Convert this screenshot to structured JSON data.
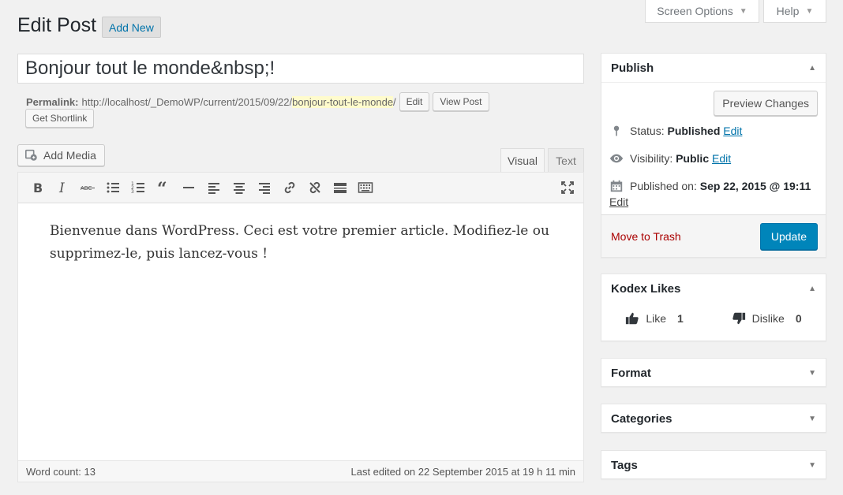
{
  "screen_meta": {
    "screen_options_label": "Screen Options",
    "help_label": "Help",
    "caret": "▼"
  },
  "header": {
    "title": "Edit Post",
    "add_new_label": "Add New"
  },
  "post": {
    "title_value": "Bonjour tout le monde&nbsp;!",
    "permalink_label": "Permalink:",
    "permalink_base": "http://localhost/_DemoWP/current/2015/09/22/",
    "permalink_slug": "bonjour-tout-le-monde",
    "permalink_trailing": "/",
    "edit_label": "Edit",
    "view_post_label": "View Post",
    "get_shortlink_label": "Get Shortlink"
  },
  "editor": {
    "add_media_label": "Add Media",
    "tab_visual": "Visual",
    "tab_text": "Text",
    "content": "Bienvenue dans WordPress. Ceci est votre premier article. Modifiez-le ou supprimez-le, puis lancez-vous !",
    "word_count": "Word count: 13",
    "last_edited": "Last edited on 22 September 2015 at 19 h 11 min",
    "toolbar_icons": [
      "bold-icon",
      "italic-icon",
      "strikethrough-icon",
      "bulleted-list-icon",
      "numbered-list-icon",
      "blockquote-icon",
      "horizontal-line-icon",
      "align-left-icon",
      "align-center-icon",
      "align-right-icon",
      "insert-link-icon",
      "remove-link-icon",
      "read-more-icon",
      "toolbar-toggle-icon",
      "fullscreen-icon"
    ]
  },
  "publish": {
    "title": "Publish",
    "preview_label": "Preview Changes",
    "status_label": "Status:",
    "status_value": "Published",
    "visibility_label": "Visibility:",
    "visibility_value": "Public",
    "published_on_label": "Published on:",
    "published_on_value": "Sep 22, 2015 @ 19:11",
    "edit_link": "Edit",
    "trash_label": "Move to Trash",
    "update_label": "Update"
  },
  "kodex": {
    "title": "Kodex Likes",
    "like_label": "Like",
    "like_count": "1",
    "dislike_label": "Dislike",
    "dislike_count": "0"
  },
  "boxes": {
    "format": "Format",
    "categories": "Categories",
    "tags": "Tags",
    "expanded_toggle": "▲",
    "collapsed_toggle": "▼"
  },
  "colors": {
    "accent": "#0073aa",
    "primary_button": "#0085ba",
    "trash": "#a00000",
    "slug_highlight": "#fffbcc",
    "background": "#f1f1f1"
  }
}
